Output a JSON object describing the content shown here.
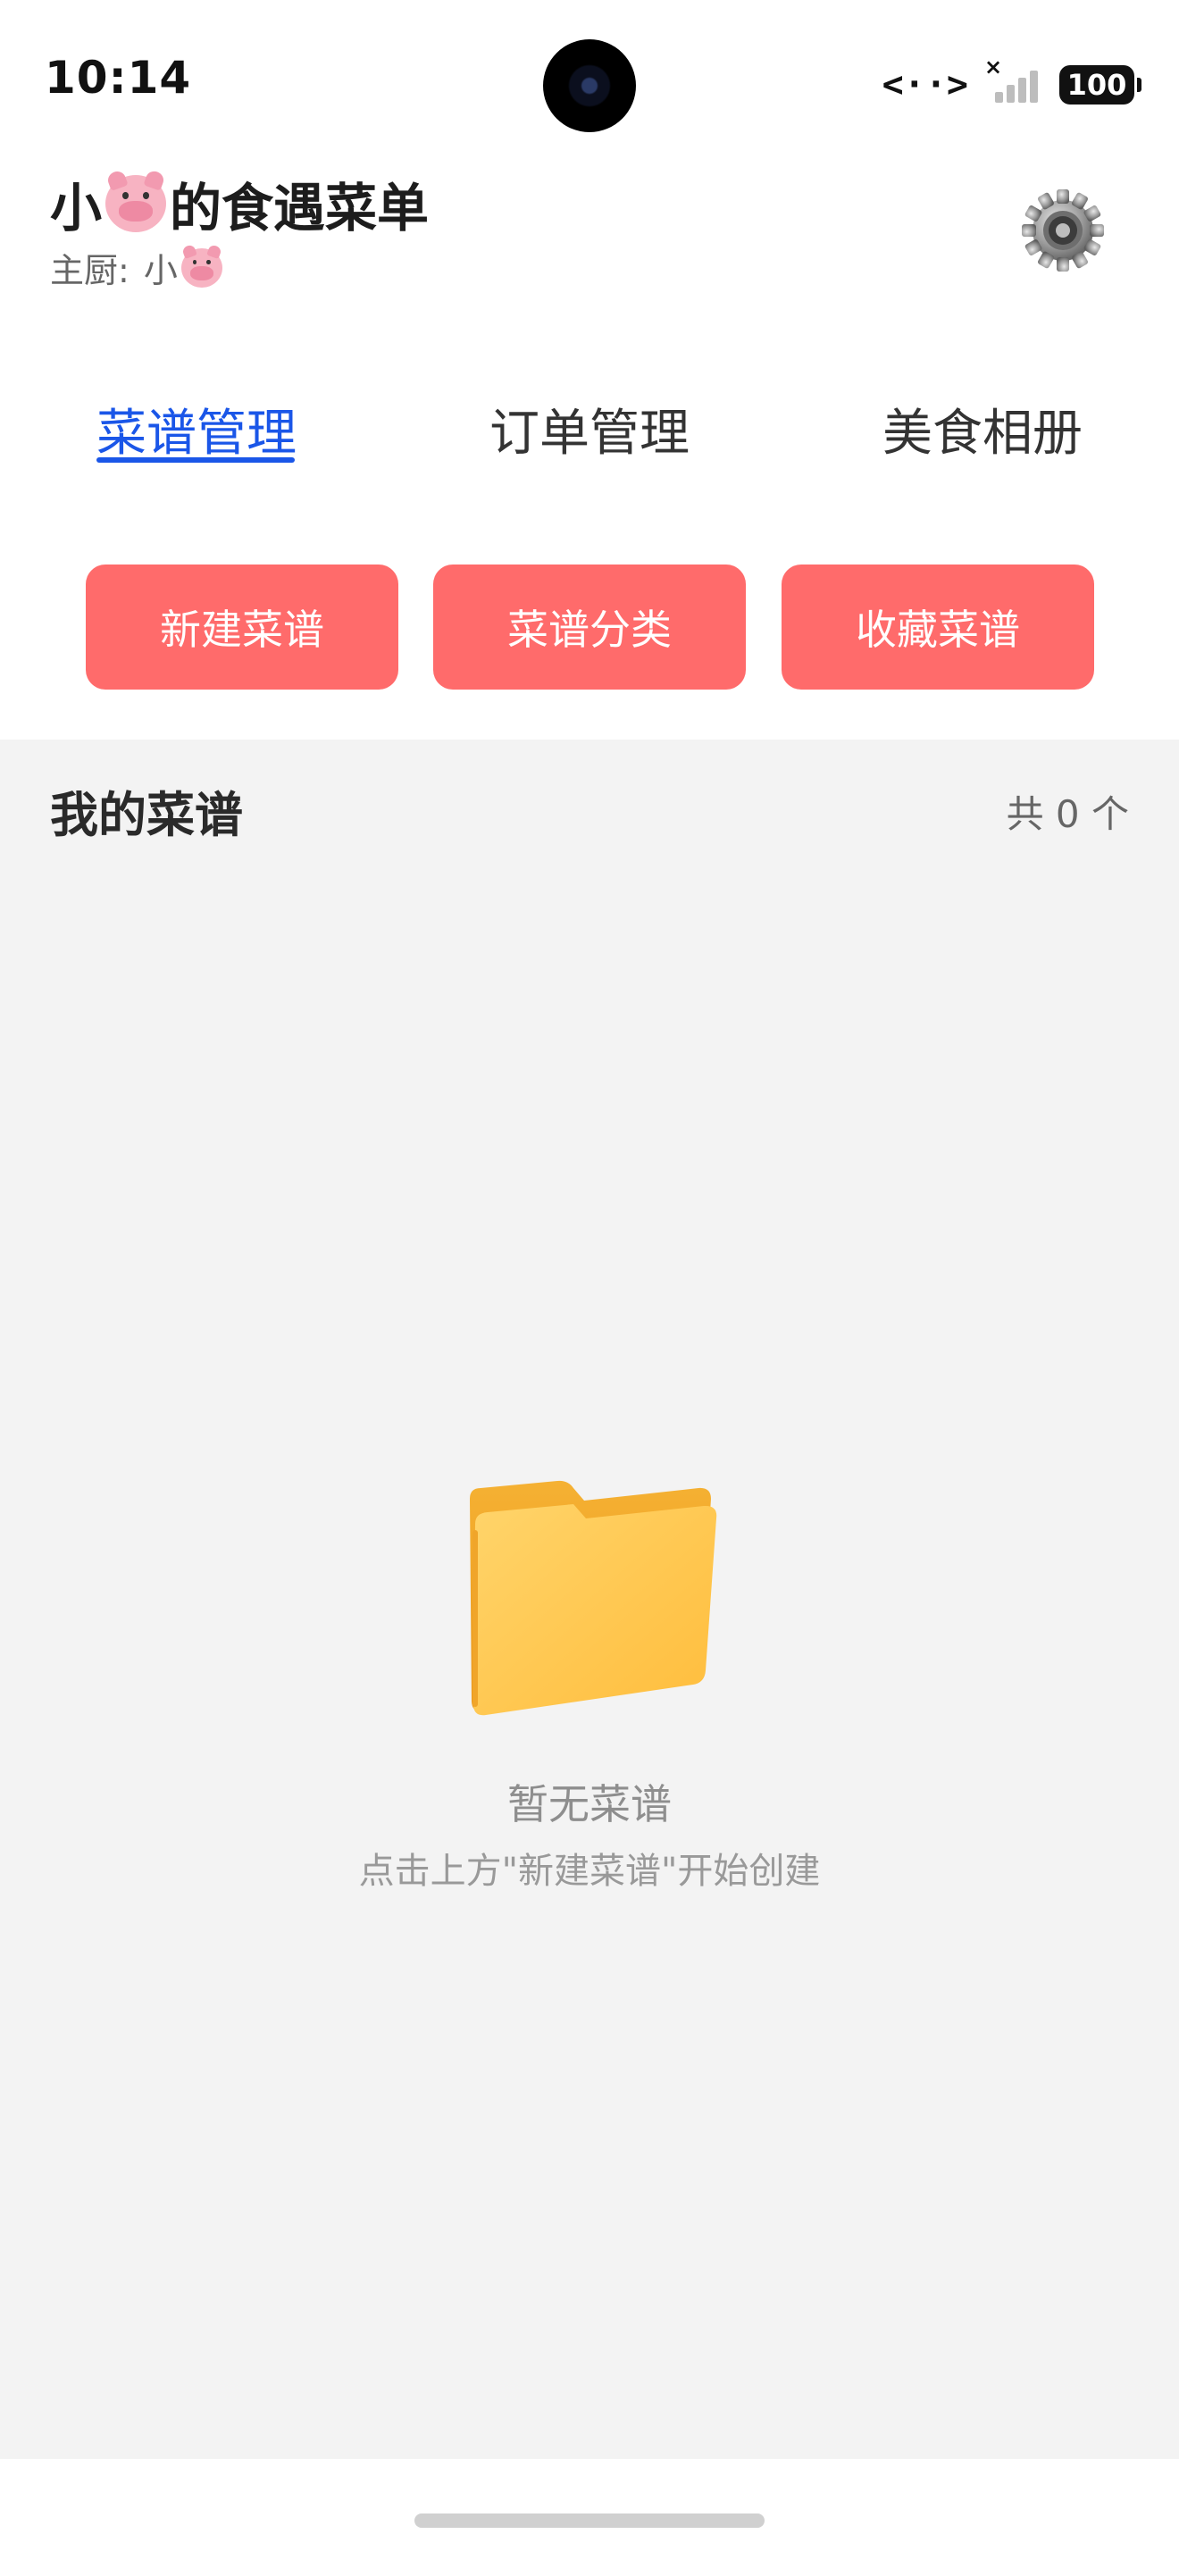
{
  "status_bar": {
    "time": "10:14",
    "data_icon": "<··>",
    "signal_icon": "signal-no-service-icon",
    "battery": "100"
  },
  "header": {
    "title_prefix": "小",
    "title_suffix": "的食遇菜单",
    "chef_label": "主厨:",
    "chef_name": "小",
    "emoji_icon": "pig-face-icon",
    "settings_icon": "gear-icon"
  },
  "tabs": [
    {
      "label": "菜谱管理",
      "active": true
    },
    {
      "label": "订单管理",
      "active": false
    },
    {
      "label": "美食相册",
      "active": false
    }
  ],
  "actions": [
    {
      "label": "新建菜谱"
    },
    {
      "label": "菜谱分类"
    },
    {
      "label": "收藏菜谱"
    }
  ],
  "recipes": {
    "section_title": "我的菜谱",
    "count_text": "共 0 个",
    "empty_icon": "folder-icon",
    "empty_title": "暂无菜谱",
    "empty_hint": "点击上方\"新建菜谱\"开始创建"
  },
  "colors": {
    "accent_blue": "#1a56e8",
    "button_red": "#ff6b6b",
    "content_bg": "#f3f3f3"
  }
}
